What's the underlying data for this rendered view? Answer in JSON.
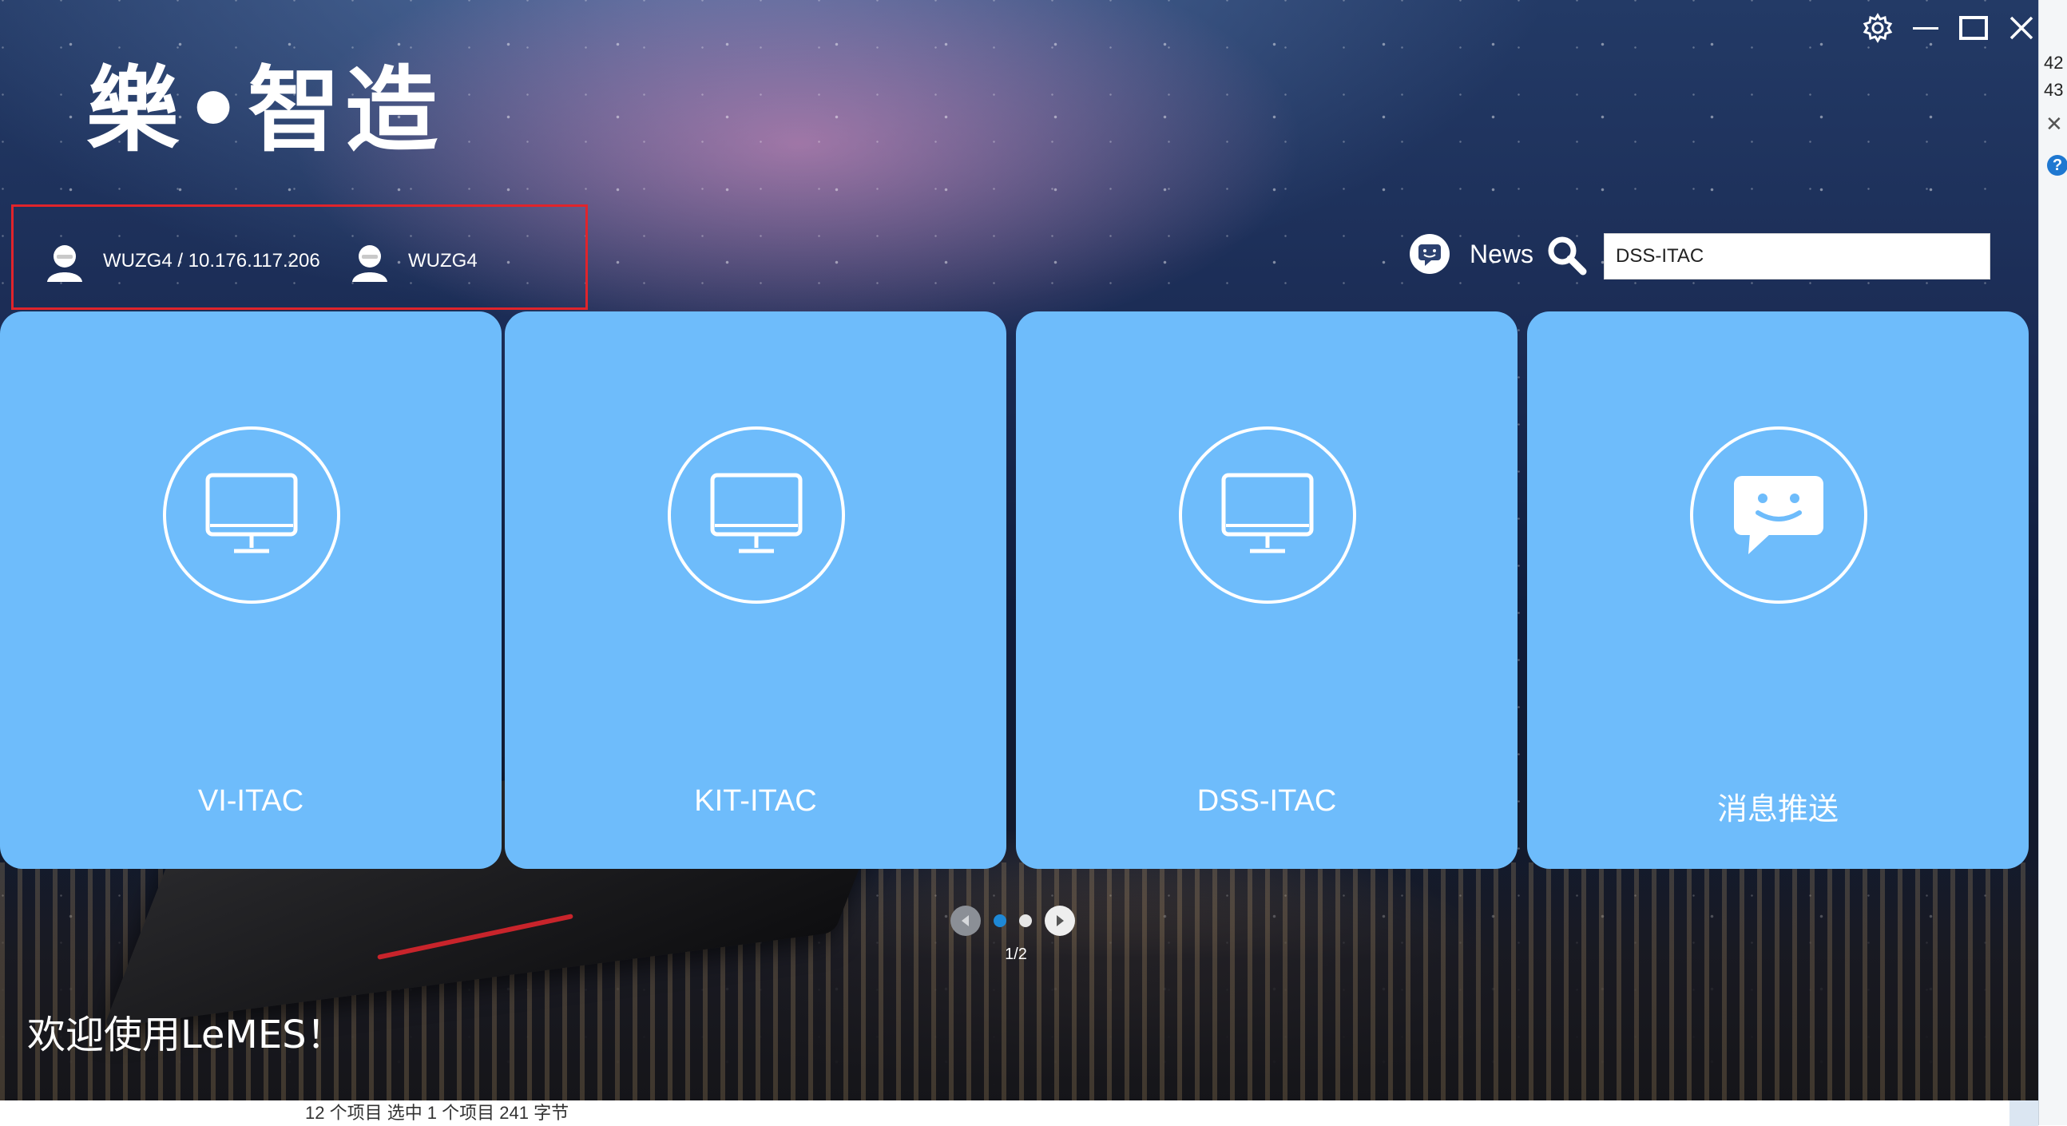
{
  "app": {
    "logo_text": "樂•智造",
    "welcome_text": "欢迎使用LeMES！"
  },
  "window_controls": {
    "icons": [
      "gear-icon",
      "minimize-icon",
      "maximize-icon",
      "close-icon"
    ]
  },
  "user": {
    "primary_label": "WUZG4 / 10.176.117.206",
    "secondary_label": "WUZG4"
  },
  "header": {
    "news_label": "News",
    "search_value": "DSS-ITAC"
  },
  "tiles": [
    {
      "label": "VI-ITAC",
      "icon": "monitor-icon"
    },
    {
      "label": "KIT-ITAC",
      "icon": "monitor-icon"
    },
    {
      "label": "DSS-ITAC",
      "icon": "monitor-icon"
    },
    {
      "label": "消息推送",
      "icon": "message-icon"
    }
  ],
  "pager": {
    "page_indicator": "1/2",
    "active_color": "#1e88d6"
  },
  "background_window": {
    "right_numbers": [
      "42",
      "43"
    ],
    "status_text": "12 个项目   选中 1 个项目  241 字节"
  },
  "colors": {
    "tile": "#6ebcfb",
    "highlight_border": "#e0242b",
    "logo_dot": "#ffbf1a"
  }
}
